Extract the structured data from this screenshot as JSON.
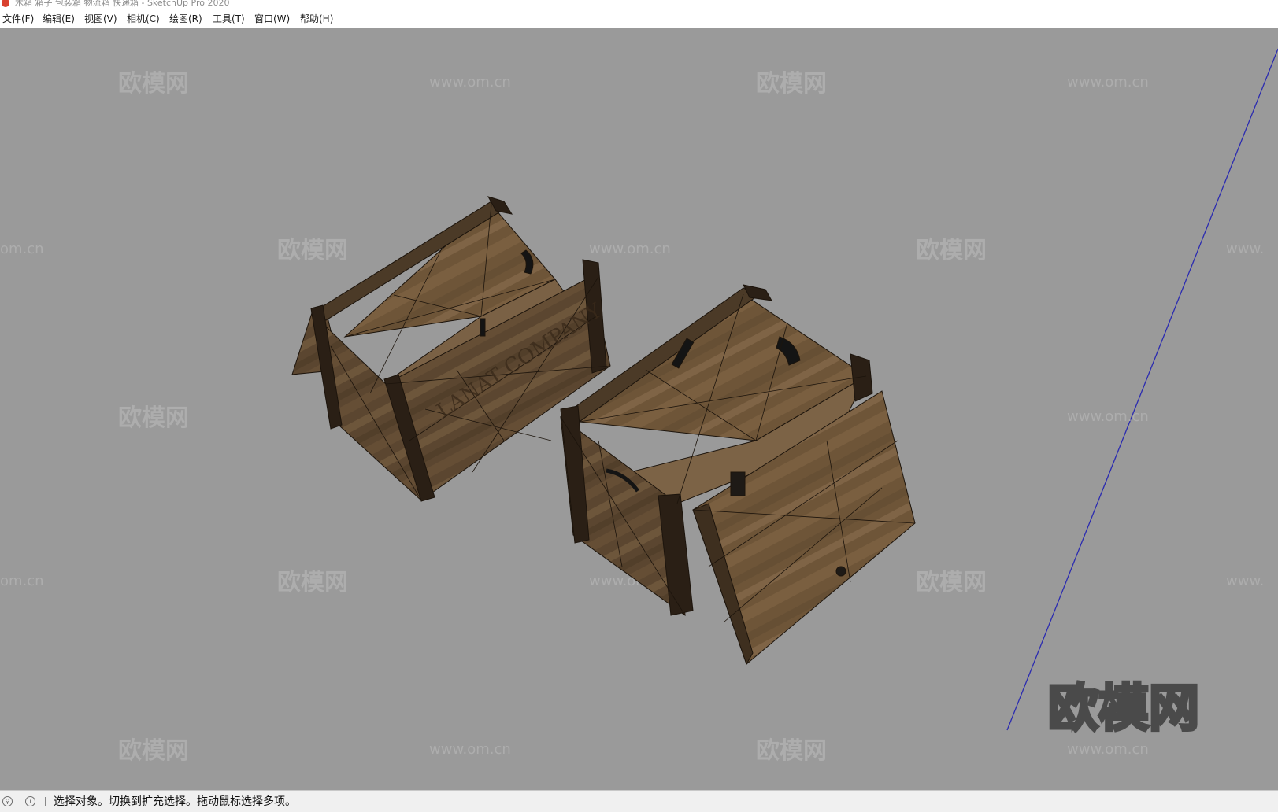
{
  "window": {
    "title": "木箱 箱子 包装箱 物流箱 快递箱 - SketchUp Pro 2020",
    "app_icon": "sketchup-logo-icon"
  },
  "menu": {
    "items": [
      {
        "label": "文件(F)"
      },
      {
        "label": "编辑(E)"
      },
      {
        "label": "视图(V)"
      },
      {
        "label": "相机(C)"
      },
      {
        "label": "绘图(R)"
      },
      {
        "label": "工具(T)"
      },
      {
        "label": "窗口(W)"
      },
      {
        "label": "帮助(H)"
      }
    ]
  },
  "viewport": {
    "background_color": "#9a9a9a",
    "axis_color": "#2b2bb0",
    "crate_text": "LANAT COMPANY",
    "watermark": {
      "brand": "欧模网",
      "url": "www.om.cn",
      "url_partial_left": "om.cn",
      "url_partial_right": "www.",
      "large_logo": "欧模网"
    }
  },
  "status": {
    "icons": [
      "geo-location-icon",
      "info-icon"
    ],
    "text": "选择对象。切换到扩充选择。拖动鼠标选择多项。"
  }
}
